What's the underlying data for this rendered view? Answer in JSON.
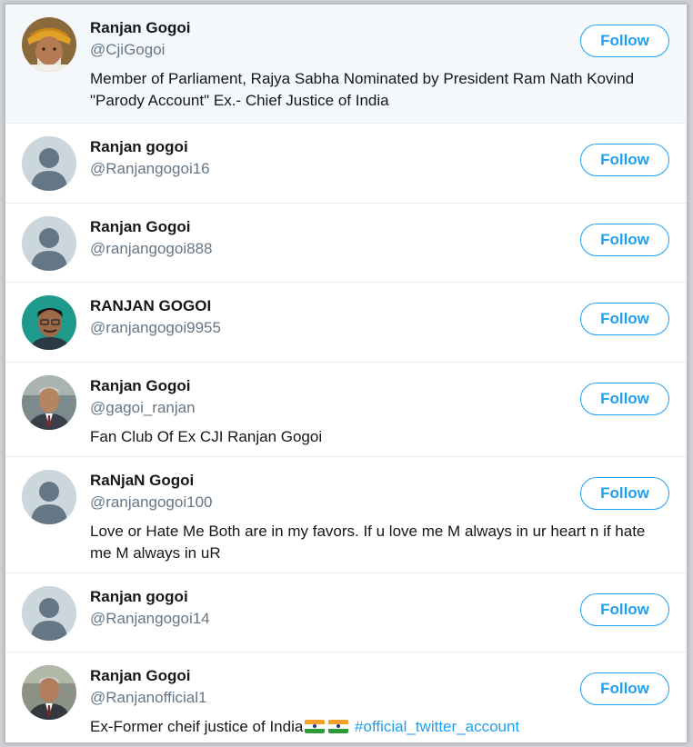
{
  "follow_label": "Follow",
  "colors": {
    "accent": "#1da1f2",
    "hover_bg": "#f5f8fa",
    "muted": "#657786"
  },
  "users": [
    {
      "name": "Ranjan Gogoi",
      "handle": "@CjiGogoi",
      "bio": "Member of Parliament, Rajya Sabha Nominated by President Ram Nath Kovind \"Parody Account\" Ex.- Chief Justice of India",
      "avatar": "turban-man-photo"
    },
    {
      "name": "Ranjan gogoi",
      "handle": "@Ranjangogoi16",
      "bio": "",
      "avatar": "default-avatar"
    },
    {
      "name": "Ranjan Gogoi",
      "handle": "@ranjangogoi888",
      "bio": "",
      "avatar": "default-avatar"
    },
    {
      "name": "RANJAN GOGOI",
      "handle": "@ranjangogoi9955",
      "bio": "",
      "avatar": "young-man-photo"
    },
    {
      "name": "Ranjan Gogoi",
      "handle": "@gagoi_ranjan",
      "bio": "Fan Club Of Ex CJI Ranjan Gogoi",
      "avatar": "suited-man-photo"
    },
    {
      "name": "RaNjaN Gogoi",
      "handle": "@ranjangogoi100",
      "bio": "Love or Hate Me Both are in my favors. If u love me M always in ur heart n if hate me M always in uR",
      "avatar": "default-avatar"
    },
    {
      "name": "Ranjan gogoi",
      "handle": "@Ranjangogoi14",
      "bio": "",
      "avatar": "default-avatar"
    },
    {
      "name": "Ranjan Gogoi",
      "handle": "@Ranjanofficial1",
      "bio": "Ex-Former cheif justice of India",
      "bio_hashtag": "#official_twitter_account",
      "avatar": "suited-man-photo"
    }
  ]
}
